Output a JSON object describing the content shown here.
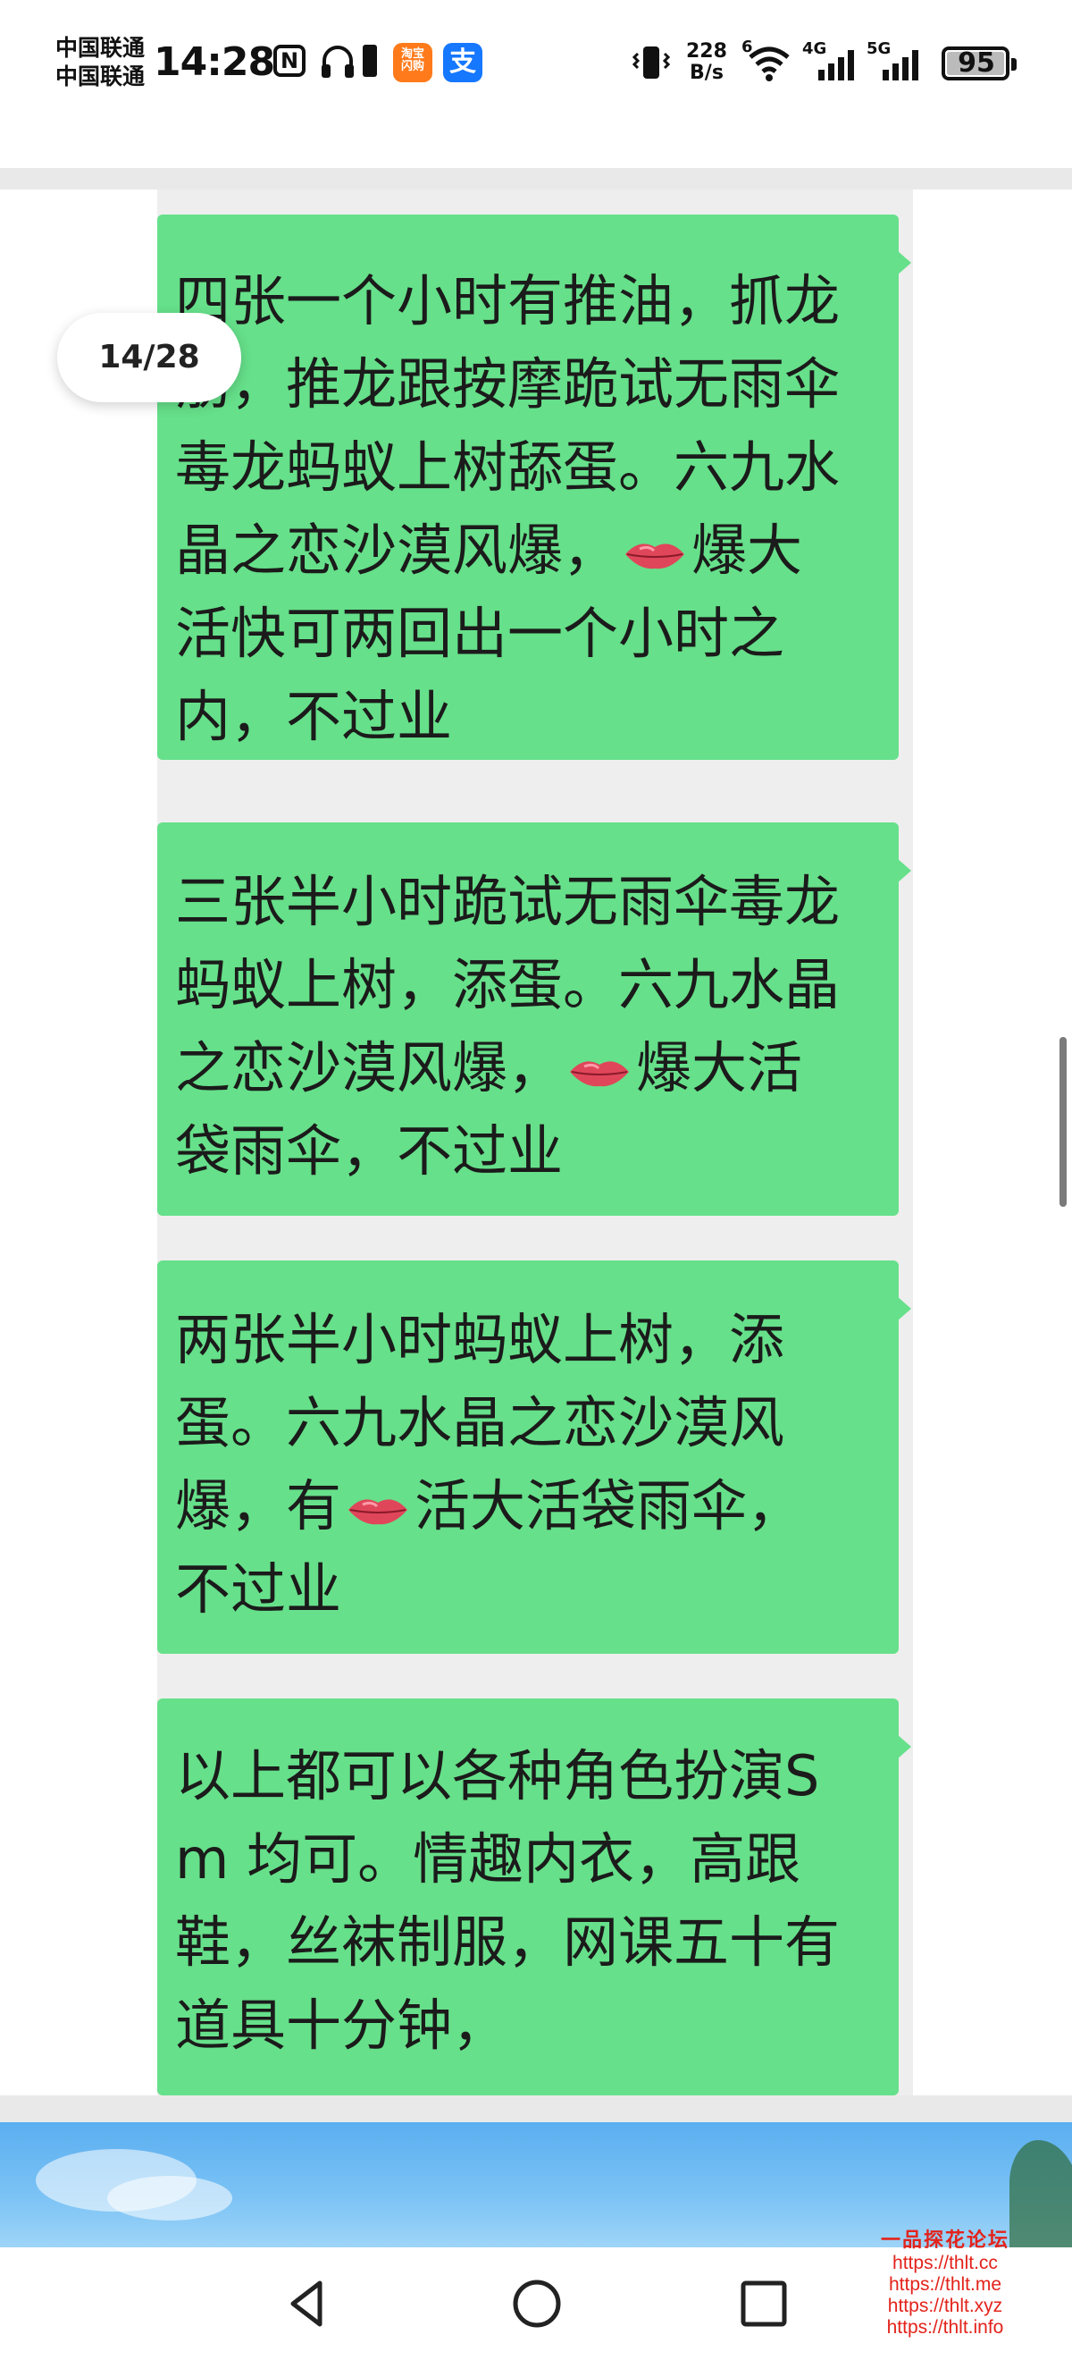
{
  "status_bar": {
    "carrier_1": "中国联通",
    "carrier_2": "中国联通",
    "time": "14:28",
    "nfc_label": "N",
    "taobao_label": "淘宝\n闪购",
    "alipay_label": "支",
    "net_speed_value": "228",
    "net_speed_unit": "B/s",
    "wifi_badge": "6",
    "sig1_badge": "4G",
    "sig2_badge": "5G",
    "battery_level": "95",
    "icons": [
      "nfc-icon",
      "headset-icon",
      "battery-saver-icon",
      "taobao-icon",
      "alipay-icon",
      "vibrate-icon",
      "wifi-icon",
      "signal-icon",
      "battery-icon"
    ]
  },
  "viewer": {
    "page_counter": "14/28"
  },
  "chat": {
    "bubble_color": "#66e08a",
    "messages": [
      {
        "before": "四张一个小时有推油，抓龙筋，推龙跟按摩跪试无雨伞毒龙蚂蚁上树舔蛋。六九水晶之恋沙漠风爆，",
        "emoji": "lips",
        "after": "爆大活快可两回出一个小时之内，不过业"
      },
      {
        "before": "三张半小时跪试无雨伞毒龙蚂蚁上树，添蛋。六九水晶之恋沙漠风爆，",
        "emoji": "lips",
        "after": "爆大活袋雨伞，不过业"
      },
      {
        "before": "两张半小时蚂蚁上树，添蛋。六九水晶之恋沙漠风爆，有",
        "emoji": "lips",
        "after": "活大活袋雨伞，不过业"
      },
      {
        "before": "以上都可以各种角色扮演Sm 均可。情趣内衣，高跟鞋，丝袜制服，网课五十有道具十分钟，",
        "emoji": "",
        "after": ""
      }
    ]
  },
  "watermark": {
    "title": "一品探花论坛",
    "urls": [
      "https://thlt.cc",
      "https://thlt.me",
      "https://thlt.xyz",
      "https://thlt.info"
    ],
    "color": "#e3231b"
  },
  "nav_bar": {
    "icons": [
      "back-icon",
      "home-icon",
      "recents-icon"
    ]
  }
}
